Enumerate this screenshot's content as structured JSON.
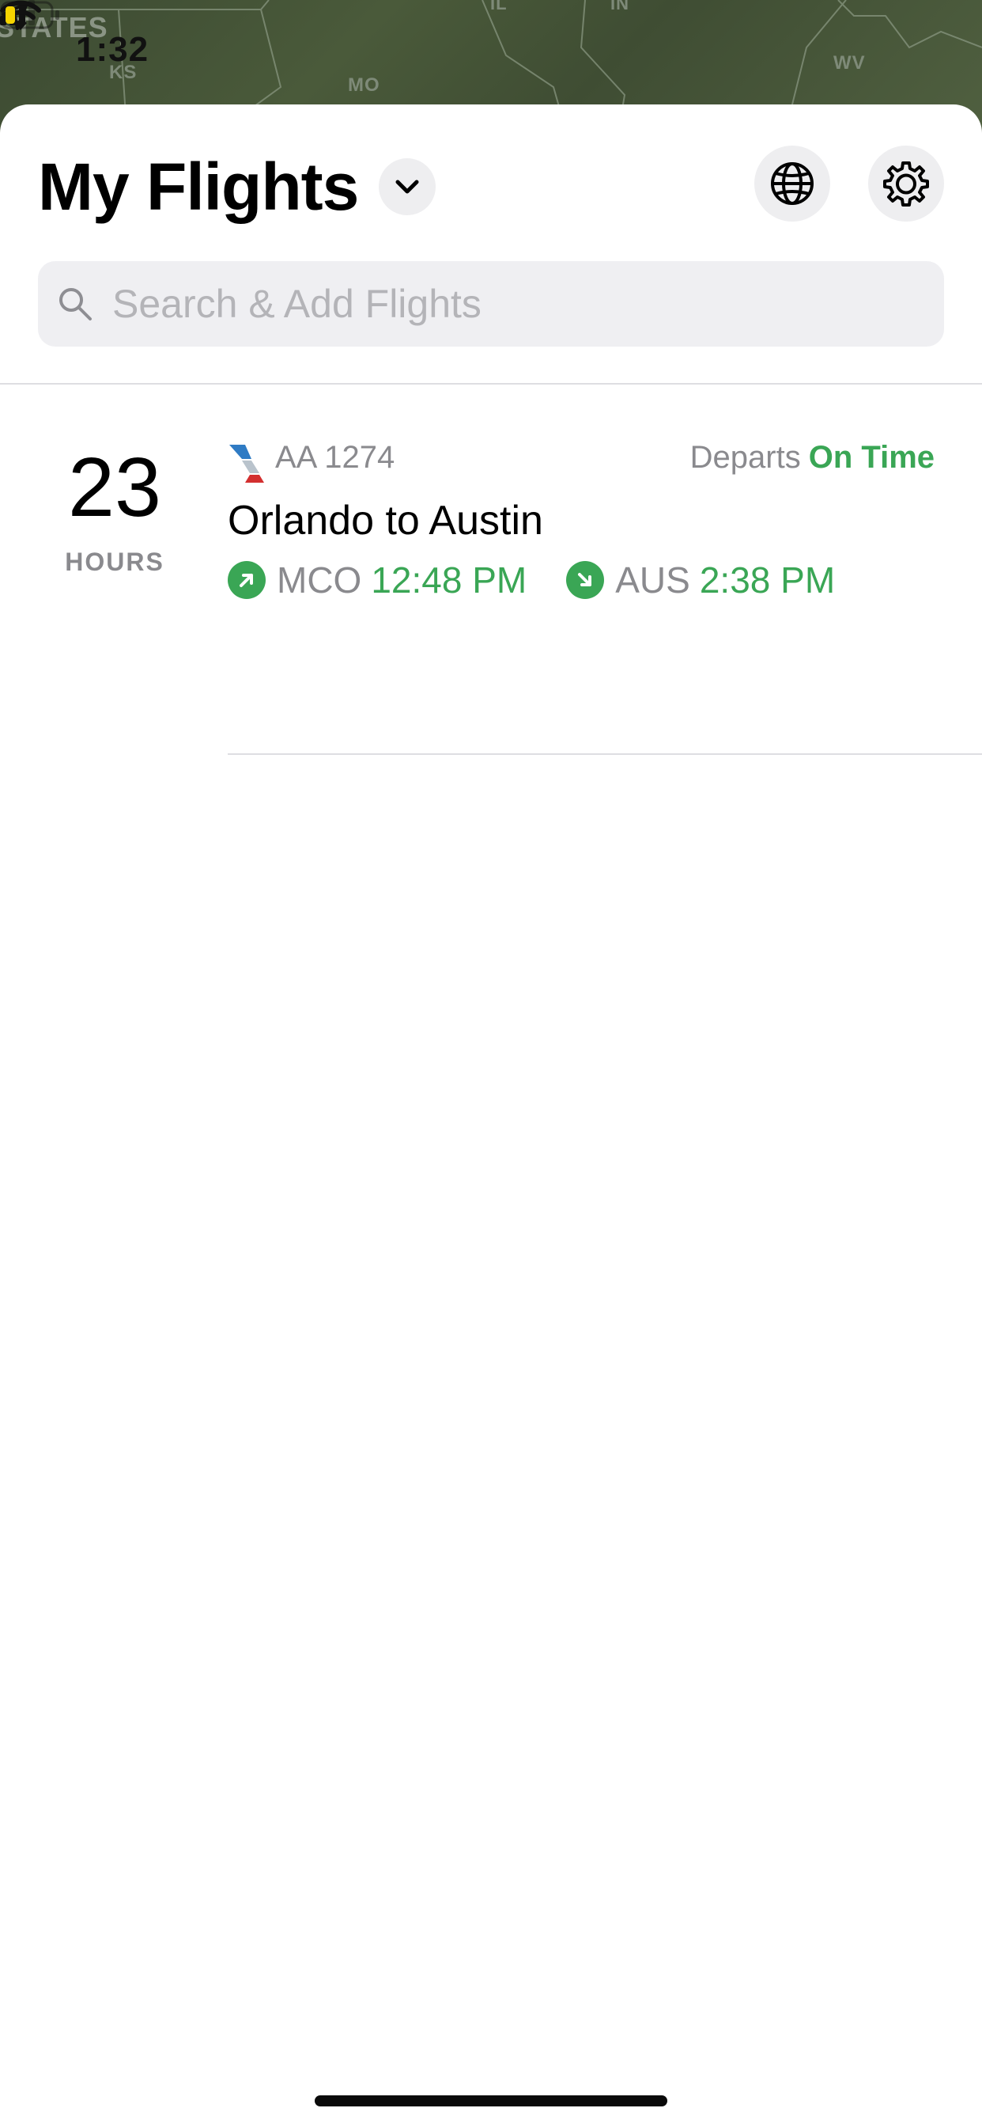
{
  "status_bar": {
    "time": "1:32",
    "location_icon": "location-arrow-icon",
    "signal_icon": "cellular-signal-icon",
    "wifi_icon": "wifi-icon",
    "battery_icon": "battery-low-icon",
    "battery_color": "#f5d400"
  },
  "map": {
    "labels": {
      "country": "STATES",
      "ks": "KS",
      "mo": "MO",
      "wv": "WV",
      "il": "IL",
      "in": "IN"
    }
  },
  "header": {
    "title": "My Flights",
    "dropdown_icon": "chevron-down-icon",
    "globe_icon": "globe-icon",
    "settings_icon": "gear-icon"
  },
  "search": {
    "placeholder": "Search & Add Flights",
    "value": "",
    "icon": "search-icon"
  },
  "flights": [
    {
      "countdown_value": "23",
      "countdown_unit": "HOURS",
      "airline_logo": "american-airlines-logo-icon",
      "flight_number": "AA 1274",
      "status_label": "Departs",
      "status_value": "On Time",
      "route": "Orlando to Austin",
      "departure_airport": "MCO",
      "departure_time": "12:48 PM",
      "arrival_airport": "AUS",
      "arrival_time": "2:38 PM"
    }
  ],
  "colors": {
    "accent_green": "#3aa655",
    "secondary_text": "#8a8a8e",
    "button_bg": "#eeeef0",
    "search_bg": "#efeff2"
  }
}
